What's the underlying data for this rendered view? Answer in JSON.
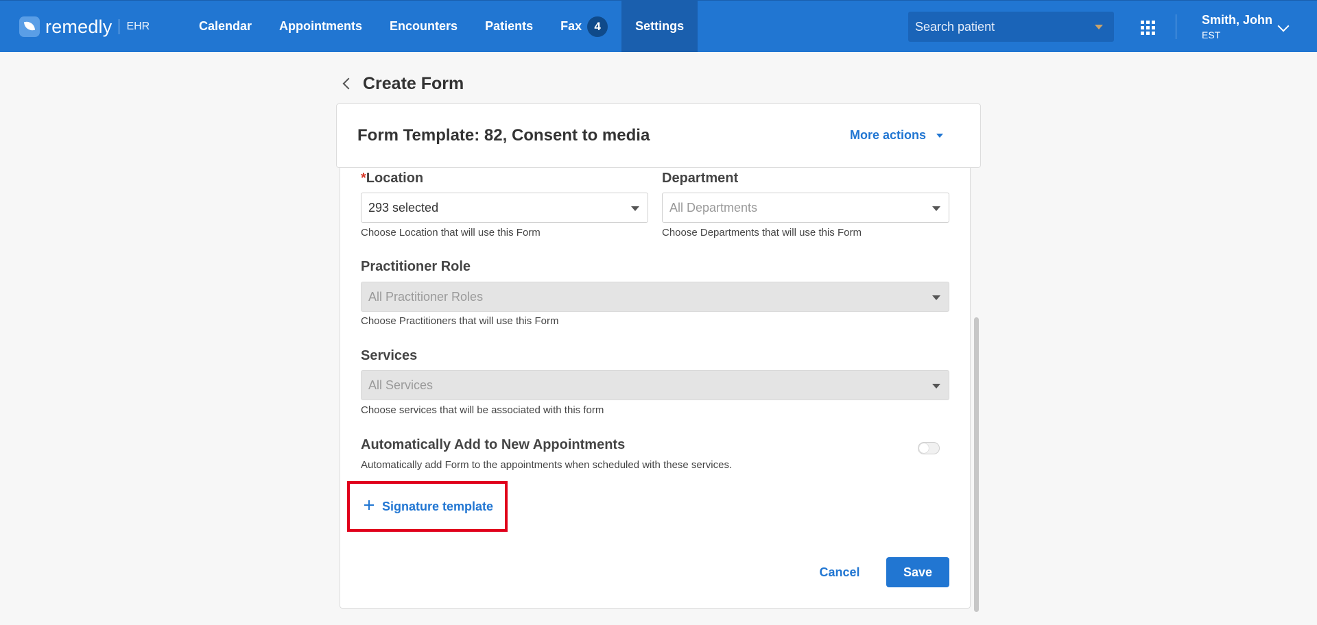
{
  "brand": {
    "name": "remedly",
    "sub": "EHR"
  },
  "nav": {
    "items": [
      {
        "label": "Calendar"
      },
      {
        "label": "Appointments"
      },
      {
        "label": "Encounters"
      },
      {
        "label": "Patients"
      },
      {
        "label": "Fax",
        "badge": "4"
      },
      {
        "label": "Settings",
        "active": true
      }
    ]
  },
  "search": {
    "placeholder": "Search patient"
  },
  "user": {
    "name": "Smith, John",
    "timezone": "EST"
  },
  "page": {
    "title": "Create Form"
  },
  "header": {
    "form_title": "Form Template: 82, Consent to media",
    "more_actions": "More actions"
  },
  "form": {
    "location": {
      "required_mark": "*",
      "label": "Location",
      "value": "293 selected",
      "helper": "Choose Location that will use this Form"
    },
    "department": {
      "label": "Department",
      "placeholder": "All Departments",
      "helper": "Choose Departments that will use this Form"
    },
    "practitioner_role": {
      "label": "Practitioner Role",
      "placeholder": "All Practitioner Roles",
      "helper": "Choose Practitioners that will use this Form"
    },
    "services": {
      "label": "Services",
      "placeholder": "All Services",
      "helper": "Choose services that will be associated with this form"
    },
    "auto_add": {
      "label": "Automatically Add to New Appointments",
      "helper": "Automatically add Form to the appointments when scheduled with these services.",
      "enabled": false
    },
    "signature_template": "Signature template",
    "cancel": "Cancel",
    "save": "Save"
  },
  "colors": {
    "primary": "#2176d2",
    "nav_active": "#1a5fae",
    "highlight": "#e0001b"
  }
}
